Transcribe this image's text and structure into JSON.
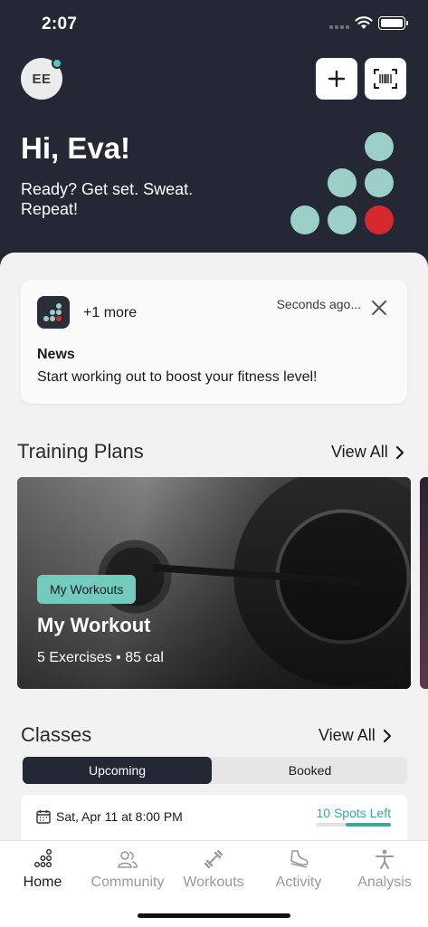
{
  "status": {
    "time": "2:07"
  },
  "header": {
    "avatar_initials": "EE",
    "greeting": "Hi, Eva!",
    "tagline": "Ready? Get set. Sweat. Repeat!",
    "accent_color": "#9ccfc7",
    "alert_color": "#d7282f"
  },
  "news": {
    "more": "+1 more",
    "time": "Seconds ago...",
    "title": "News",
    "body": "Start working out to boost your fitness level!"
  },
  "training_plans": {
    "title": "Training Plans",
    "view_all": "View All",
    "card": {
      "badge": "My Workouts",
      "name": "My Workout",
      "meta": "5 Exercises • 85 cal"
    }
  },
  "classes": {
    "title": "Classes",
    "view_all": "View All",
    "tabs": [
      "Upcoming",
      "Booked"
    ],
    "selected_tab": "Upcoming",
    "item": {
      "date": "Sat, Apr 11 at 8:00 PM",
      "spots": "10 Spots Left",
      "spots_fill": 0.6
    }
  },
  "tabbar": {
    "items": [
      {
        "label": "Home",
        "icon": "home-dots-icon",
        "active": true
      },
      {
        "label": "Community",
        "icon": "people-icon",
        "active": false
      },
      {
        "label": "Workouts",
        "icon": "dumbbell-icon",
        "active": false
      },
      {
        "label": "Activity",
        "icon": "shoe-icon",
        "active": false
      },
      {
        "label": "Analysis",
        "icon": "person-icon",
        "active": false
      }
    ]
  }
}
